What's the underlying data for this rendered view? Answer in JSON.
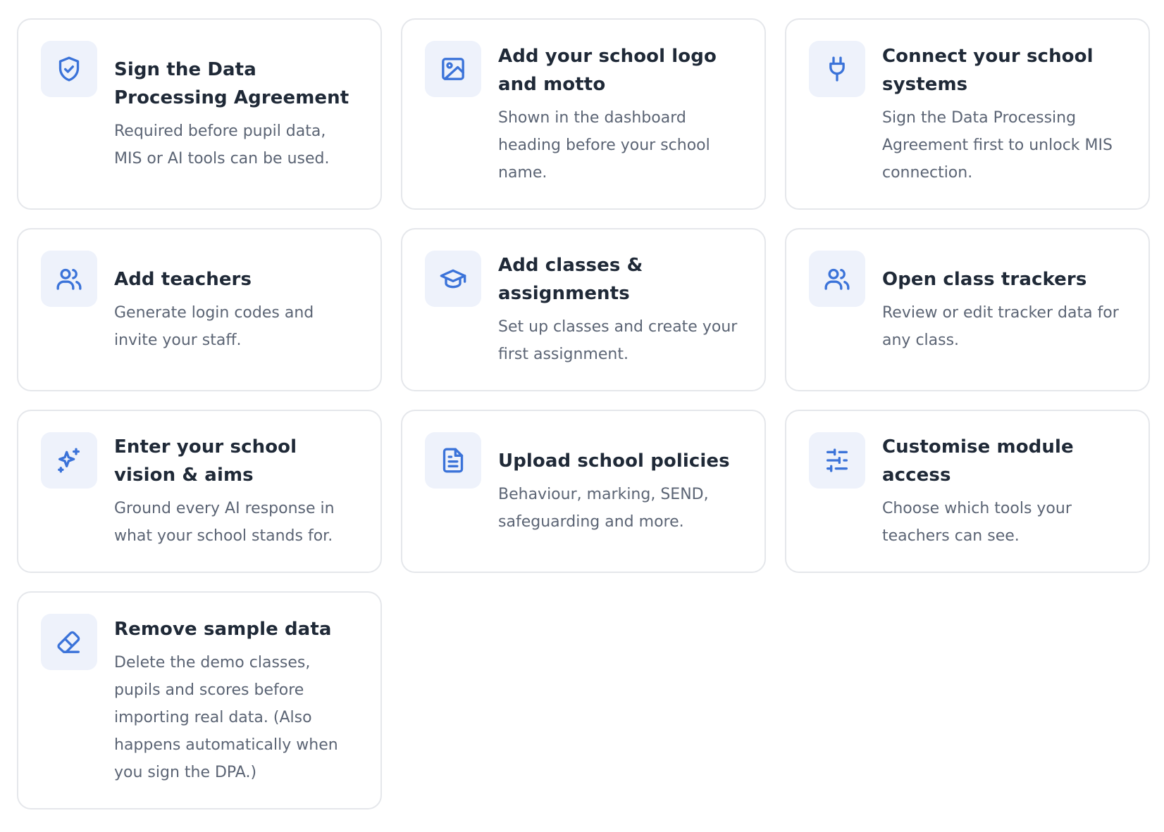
{
  "cards": [
    {
      "title": "Sign the Data Processing Agreement",
      "description": "Required before pupil data, MIS or AI tools can be used.",
      "icon": "shield-check-icon"
    },
    {
      "title": "Add your school logo and motto",
      "description": "Shown in the dashboard heading before your school name.",
      "icon": "image-icon"
    },
    {
      "title": "Connect your school systems",
      "description": "Sign the Data Processing Agreement first to unlock MIS connection.",
      "icon": "plug-icon"
    },
    {
      "title": "Add teachers",
      "description": "Generate login codes and invite your staff.",
      "icon": "users-icon"
    },
    {
      "title": "Add classes & assignments",
      "description": "Set up classes and create your first assignment.",
      "icon": "graduation-cap-icon"
    },
    {
      "title": "Open class trackers",
      "description": "Review or edit tracker data for any class.",
      "icon": "users-icon"
    },
    {
      "title": "Enter your school vision & aims",
      "description": "Ground every AI response in what your school stands for.",
      "icon": "sparkles-icon"
    },
    {
      "title": "Upload school policies",
      "description": "Behaviour, marking, SEND, safeguarding and more.",
      "icon": "file-text-icon"
    },
    {
      "title": "Customise module access",
      "description": "Choose which tools your teachers can see.",
      "icon": "sliders-icon"
    },
    {
      "title": "Remove sample data",
      "description": "Delete the demo classes, pupils and scores before importing real data. (Also happens automatically when you sign the DPA.)",
      "icon": "eraser-icon"
    }
  ],
  "colors": {
    "accent": "#3b73d9",
    "icon_bg": "#eef2fb",
    "border": "#e5e7eb",
    "title": "#1f2937",
    "description": "#5b6474"
  }
}
